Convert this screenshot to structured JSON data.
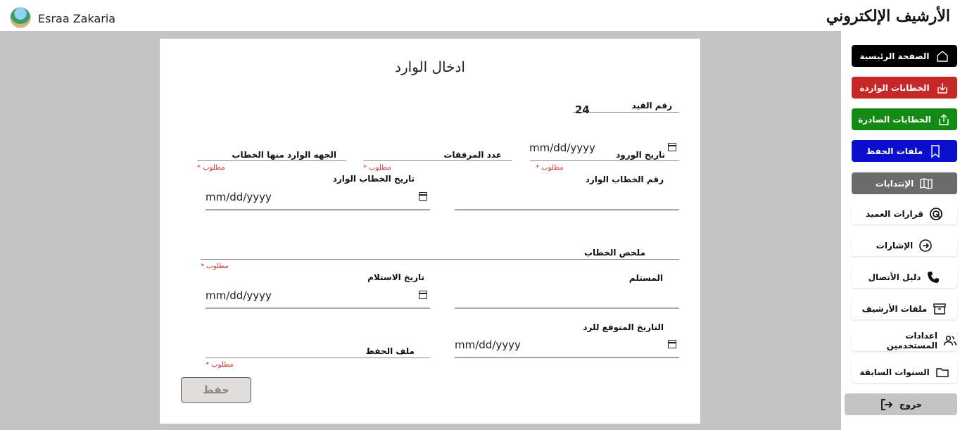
{
  "header": {
    "user_name": "Esraa Zakaria",
    "app_title": "الأرشيف الإلكتروني"
  },
  "sidebar": {
    "items": [
      {
        "label": "الصفحة الرئيسية",
        "icon": "home-icon",
        "bg": "#000000",
        "color": "#ffffff"
      },
      {
        "label": "الخطابات الواردة",
        "icon": "download-icon",
        "bg": "#c62828",
        "color": "#ffffff"
      },
      {
        "label": "الخطابات الصادرة",
        "icon": "upload-icon",
        "bg": "#138a13",
        "color": "#ffffff"
      },
      {
        "label": "ملفات الحفظ",
        "icon": "bookmark-icon",
        "bg": "#0a0fcc",
        "color": "#ffffff"
      },
      {
        "label": "الإنتدابات",
        "icon": "map-icon",
        "bg": "#6b6b6b",
        "color": "#ffffff"
      },
      {
        "label": "قرارات العميد",
        "icon": "target-icon"
      },
      {
        "label": "الإشارات",
        "icon": "arrow-circle-icon"
      },
      {
        "label": "دليل الأتصال",
        "icon": "phone-icon"
      },
      {
        "label": "ملفات الأرشيف",
        "icon": "archive-icon"
      },
      {
        "label": "اعدادات المستخدمين",
        "icon": "users-icon"
      },
      {
        "label": "السنوات السابقة",
        "icon": "folder-icon"
      }
    ],
    "logout": {
      "label": "خروج",
      "icon": "logout-icon",
      "bg": "#c4c4c4"
    }
  },
  "form": {
    "title": "ادخال الوارد",
    "required_text": "مطلوب *",
    "date_placeholder": "mm/dd/yyyy",
    "record_number": {
      "label": "رقم القيد",
      "value": "24"
    },
    "arrival_date": {
      "label": "تاريخ الورود"
    },
    "attachments_count": {
      "label": "عدد المرفقات"
    },
    "sender_entity": {
      "label": "الجهه الوارد منها الخطاب"
    },
    "incoming_letter_number": {
      "label": "رقم الخطاب الوارد"
    },
    "incoming_letter_date": {
      "label": "تاريخ الخطاب الوارد"
    },
    "letter_summary": {
      "label": "ملخص الخطاب"
    },
    "recipient": {
      "label": "المستلم"
    },
    "receipt_date": {
      "label": "تاريخ الاستلام"
    },
    "expected_reply_date": {
      "label": "التاريخ المتوقع للرد"
    },
    "save_file": {
      "label": "ملف الحفظ"
    },
    "save_button": "حفظ"
  }
}
